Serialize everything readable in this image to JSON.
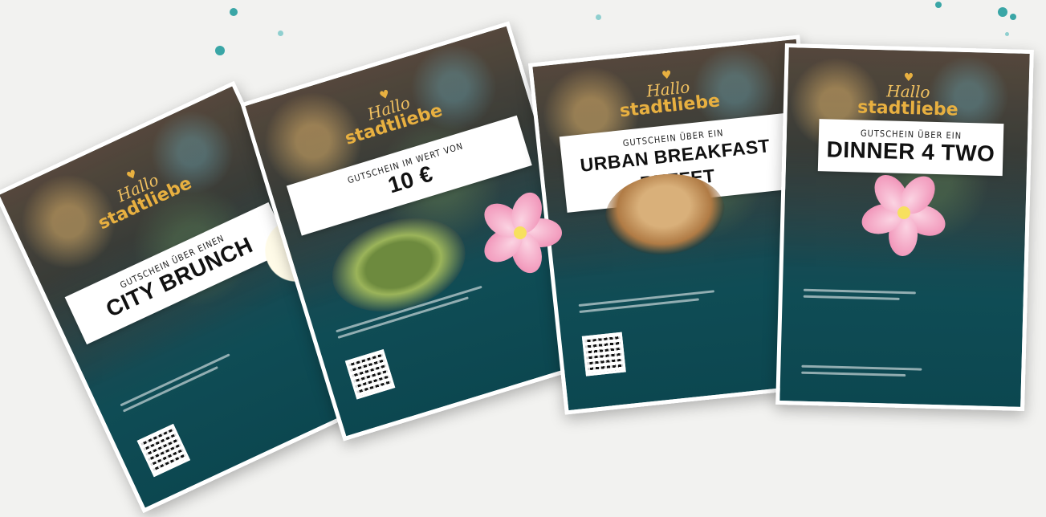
{
  "brand": {
    "logo_line1": "Hallo",
    "logo_line2": "stadtliebe"
  },
  "vouchers": [
    {
      "id": "city-brunch",
      "subtitle": "GUTSCHEIN ÜBER EINEN",
      "title": "CITY BRUNCH"
    },
    {
      "id": "wert",
      "subtitle": "GUTSCHEIN IM WERT VON",
      "title": "10 €"
    },
    {
      "id": "breakfast",
      "subtitle": "GUTSCHEIN ÜBER EIN",
      "title": "URBAN BREAKFAST BUFFET"
    },
    {
      "id": "dinner",
      "subtitle": "GUTSCHEIN ÜBER EIN",
      "title": "DINNER 4 TWO"
    }
  ],
  "colors": {
    "card": "#0f4c55",
    "accent": "#e8b040",
    "speck": "#3aa6a6",
    "flower": "#f29bbd"
  }
}
